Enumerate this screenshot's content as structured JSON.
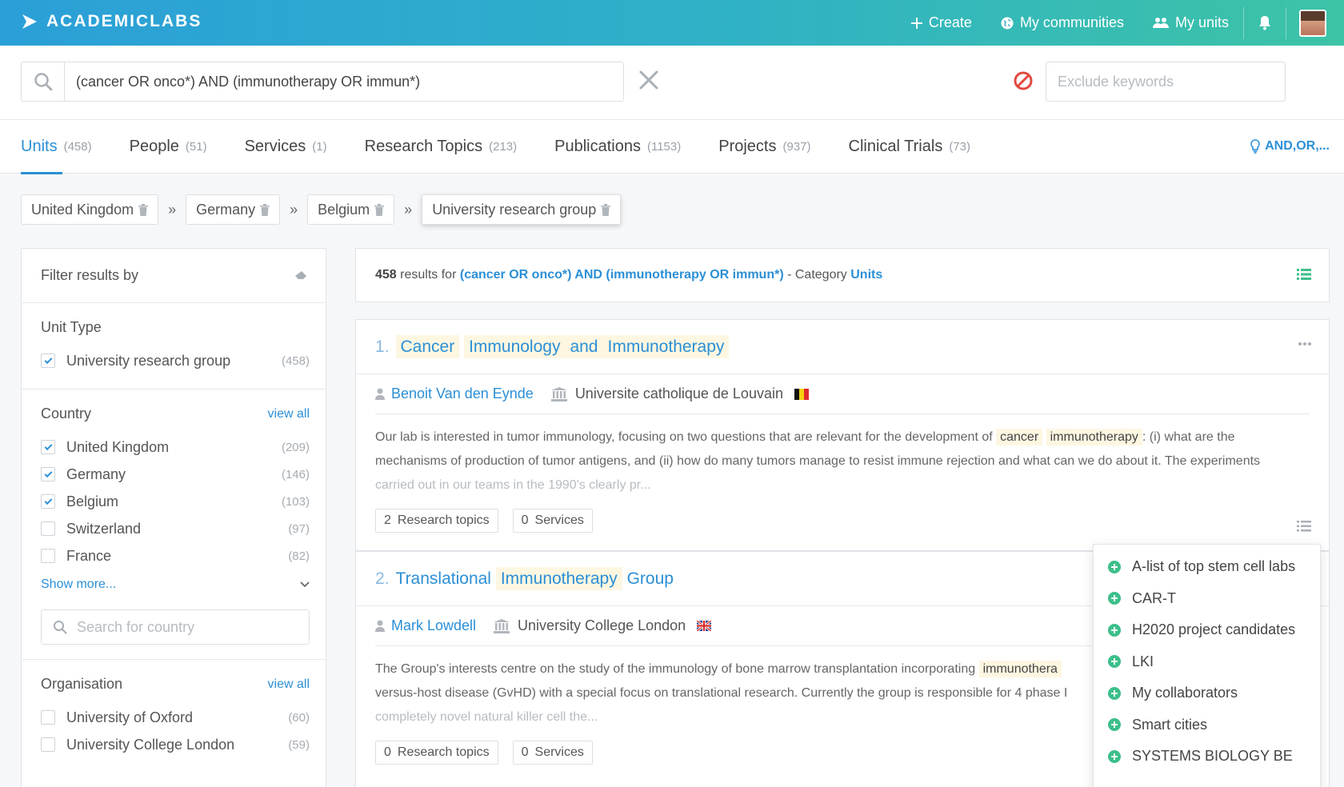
{
  "header": {
    "brand": "ACADEMICLABS",
    "nav": [
      {
        "label": "Create",
        "icon": "plus-icon"
      },
      {
        "label": "My communities",
        "icon": "globe-icon"
      },
      {
        "label": "My units",
        "icon": "users-icon"
      }
    ]
  },
  "search": {
    "query": "(cancer OR onco*) AND (immunotherapy OR immun*)",
    "exclude_placeholder": "Exclude keywords"
  },
  "tabs": [
    {
      "label": "Units",
      "count": "(458)",
      "active": true
    },
    {
      "label": "People",
      "count": "(51)"
    },
    {
      "label": "Services",
      "count": "(1)"
    },
    {
      "label": "Research Topics",
      "count": "(213)"
    },
    {
      "label": "Publications",
      "count": "(1153)"
    },
    {
      "label": "Projects",
      "count": "(937)"
    },
    {
      "label": "Clinical Trials",
      "count": "(73)"
    }
  ],
  "tip": "AND,OR,...",
  "breadcrumb": [
    "United Kingdom",
    "Germany",
    "Belgium",
    "University research group"
  ],
  "breadcrumb_sep": "»",
  "sidebar": {
    "title": "Filter results by",
    "unit_type": {
      "title": "Unit Type",
      "items": [
        {
          "label": "University research group",
          "count": "(458)",
          "checked": true
        }
      ]
    },
    "country": {
      "title": "Country",
      "view_all": "view all",
      "items": [
        {
          "label": "United Kingdom",
          "count": "(209)",
          "checked": true
        },
        {
          "label": "Germany",
          "count": "(146)",
          "checked": true
        },
        {
          "label": "Belgium",
          "count": "(103)",
          "checked": true
        },
        {
          "label": "Switzerland",
          "count": "(97)",
          "checked": false
        },
        {
          "label": "France",
          "count": "(82)",
          "checked": false
        }
      ],
      "show_more": "Show more...",
      "search_placeholder": "Search for country"
    },
    "organisation": {
      "title": "Organisation",
      "view_all": "view all",
      "items": [
        {
          "label": "University of Oxford",
          "count": "(60)",
          "checked": false
        },
        {
          "label": "University College London",
          "count": "(59)",
          "checked": false
        }
      ]
    }
  },
  "results": {
    "count": "458",
    "text_results_for": "results for",
    "query": "(cancer OR onco*) AND (immunotherapy OR immun*)",
    "text_category": "- Category",
    "category": "Units"
  },
  "cards": [
    {
      "num": "1.",
      "title_words": [
        "Cancer",
        "Immunology",
        "and",
        "Immunotherapy"
      ],
      "person": "Benoit Van den Eynde",
      "institution": "Universite catholique de Louvain",
      "desc_a": "Our lab is interested in tumor immunology, focusing on two questions that are relevant for the development of",
      "desc_hl1": "cancer",
      "desc_hl2": "immunotherapy",
      "desc_b": ": (i) what are the mechanisms of production of tumor antigens, and (ii) how do many tumors manage to resist immune rejection and what can we do about it. The experiments",
      "desc_fade": "carried out in our teams in the 1990's clearly pr...",
      "pill1": {
        "n": "2",
        "label": "Research topics"
      },
      "pill2": {
        "n": "0",
        "label": "Services"
      }
    },
    {
      "num": "2.",
      "title_words": [
        "Translational",
        "Immunotherapy",
        "Group"
      ],
      "person": "Mark Lowdell",
      "institution": "University College London",
      "desc_a": "The Group's interests centre on the study of the immunology of bone marrow transplantation incorporating",
      "desc_hl1": "immunothera",
      "desc_b2": "versus-host disease (GvHD) with a special focus on translational research. Currently the group is responsible for 4 phase I",
      "desc_fade": "completely novel natural killer cell the...",
      "pill1": {
        "n": "0",
        "label": "Research topics"
      },
      "pill2": {
        "n": "0",
        "label": "Services"
      }
    }
  ],
  "dropdown": [
    "A-list of top stem cell labs",
    "CAR-T",
    "H2020 project candidates",
    "LKI",
    "My collaborators",
    "Smart cities",
    "SYSTEMS BIOLOGY BE"
  ],
  "colors": {
    "accent": "#2b8fd6",
    "header_start": "#2b9fd8",
    "header_end": "#3dc3a6",
    "green": "#3dbf8a",
    "highlight": "#fdf6e1"
  }
}
